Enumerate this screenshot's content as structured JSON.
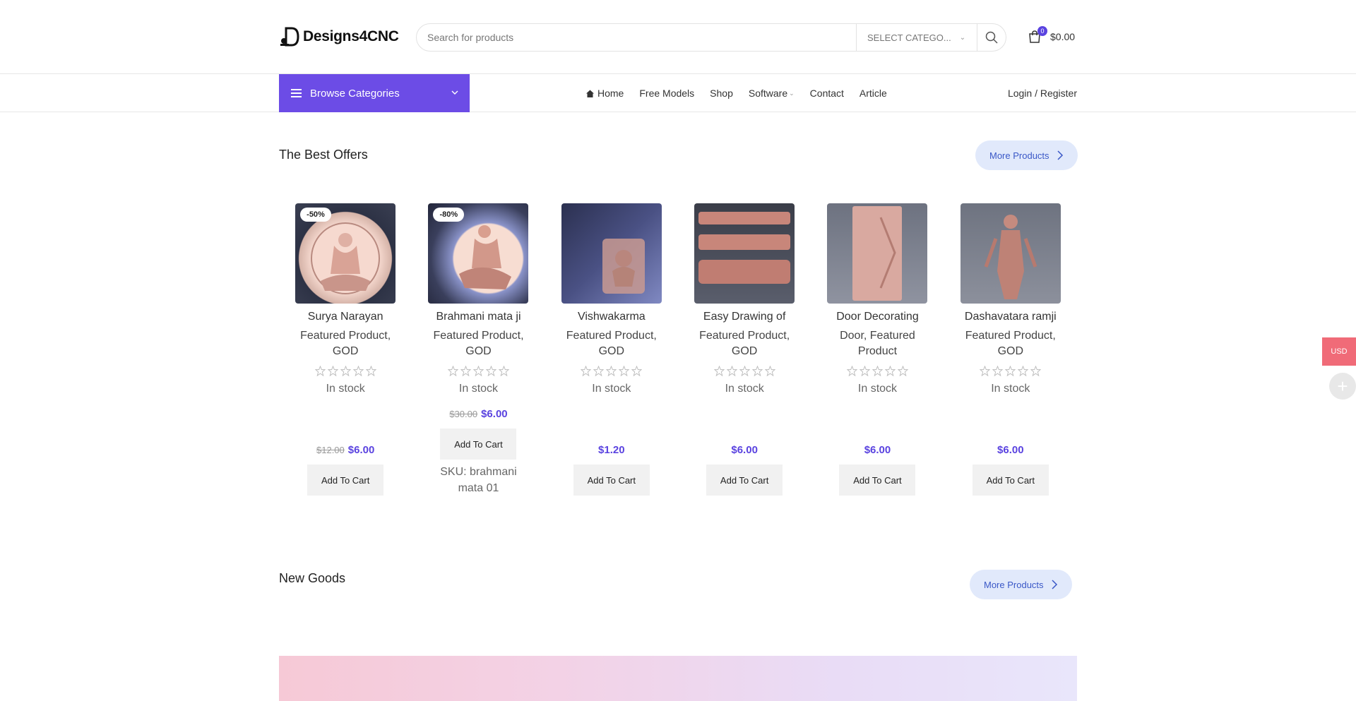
{
  "header": {
    "logo_text": "Designs4CNC",
    "search_placeholder": "Search for products",
    "category_select": "SELECT CATEGO...",
    "cart_count": "0",
    "cart_total": "$0.00"
  },
  "nav": {
    "browse_label": "Browse Categories",
    "items": [
      "Home",
      "Free Models",
      "Shop",
      "Software",
      "Contact",
      "Article"
    ],
    "login": "Login / Register"
  },
  "best_offers": {
    "title": "The Best Offers",
    "more": "More Products",
    "products": [
      {
        "name": "Surya Narayan",
        "cats": "Featured Product, GOD",
        "stock": "In stock",
        "old_price": "$12.00",
        "price": "$6.00",
        "badge": "-50%",
        "add": "Add To Cart"
      },
      {
        "name": "Brahmani mata ji",
        "cats": "Featured Product, GOD",
        "stock": "In stock",
        "old_price": "$30.00",
        "price": "$6.00",
        "badge": "-80%",
        "add": "Add To Cart",
        "sku": "SKU: brahmani mata 01"
      },
      {
        "name": "Vishwakarma",
        "cats": "Featured Product, GOD",
        "stock": "In stock",
        "old_price": "",
        "price": "$1.20",
        "badge": "",
        "add": "Add To Cart"
      },
      {
        "name": "Easy Drawing of",
        "cats": "Featured Product, GOD",
        "stock": "In stock",
        "old_price": "",
        "price": "$6.00",
        "badge": "",
        "add": "Add To Cart"
      },
      {
        "name": "Door Decorating",
        "cats": "Door, Featured Product",
        "stock": "In stock",
        "old_price": "",
        "price": "$6.00",
        "badge": "",
        "add": "Add To Cart"
      },
      {
        "name": "Dashavatara ramji",
        "cats": "Featured Product, GOD",
        "stock": "In stock",
        "old_price": "",
        "price": "$6.00",
        "badge": "",
        "add": "Add To Cart"
      }
    ]
  },
  "new_goods": {
    "title": "New Goods",
    "more": "More Products"
  },
  "side": {
    "currency": "USD"
  },
  "colors": {
    "accent": "#6c4ce6",
    "price": "#5a43e0",
    "currency_tab": "#f06b78"
  }
}
